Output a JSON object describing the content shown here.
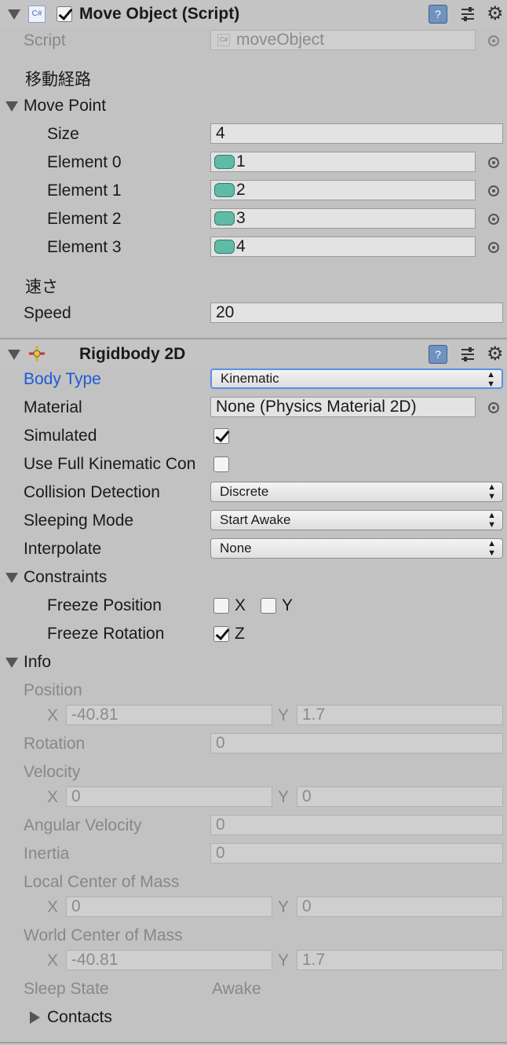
{
  "move_object": {
    "title": "Move Object (Script)",
    "script_label": "Script",
    "script_value": "moveObject",
    "header_route": "移動経路",
    "move_point_label": "Move Point",
    "size_label": "Size",
    "size_value": "4",
    "elements": [
      {
        "label": "Element 0",
        "value": "1"
      },
      {
        "label": "Element 1",
        "value": "2"
      },
      {
        "label": "Element 2",
        "value": "3"
      },
      {
        "label": "Element 3",
        "value": "4"
      }
    ],
    "header_speed": "速さ",
    "speed_label": "Speed",
    "speed_value": "20"
  },
  "rigidbody": {
    "title": "Rigidbody 2D",
    "body_type_label": "Body Type",
    "body_type_value": "Kinematic",
    "material_label": "Material",
    "material_value": "None (Physics Material 2D)",
    "simulated_label": "Simulated",
    "simulated_checked": true,
    "full_kinematic_label": "Use Full Kinematic Con",
    "full_kinematic_checked": false,
    "collision_label": "Collision Detection",
    "collision_value": "Discrete",
    "sleeping_label": "Sleeping Mode",
    "sleeping_value": "Start Awake",
    "interpolate_label": "Interpolate",
    "interpolate_value": "None",
    "constraints_label": "Constraints",
    "freeze_position_label": "Freeze Position",
    "freeze_x": "X",
    "freeze_y": "Y",
    "freeze_rotation_label": "Freeze Rotation",
    "freeze_z": "Z"
  },
  "info": {
    "label": "Info",
    "position_label": "Position",
    "position_x": "-40.81",
    "position_y": "1.7",
    "rotation_label": "Rotation",
    "rotation_value": "0",
    "velocity_label": "Velocity",
    "velocity_x": "0",
    "velocity_y": "0",
    "angular_velocity_label": "Angular Velocity",
    "angular_velocity_value": "0",
    "inertia_label": "Inertia",
    "inertia_value": "0",
    "local_com_label": "Local Center of Mass",
    "local_com_x": "0",
    "local_com_y": "0",
    "world_com_label": "World Center of Mass",
    "world_com_x": "-40.81",
    "world_com_y": "1.7",
    "sleep_state_label": "Sleep State",
    "sleep_state_value": "Awake",
    "contacts_label": "Contacts",
    "axis_x": "X",
    "axis_y": "Y"
  },
  "icons": {
    "script_file": "cs-script-icon",
    "component_rigidbody": "rigidbody-icon",
    "help": "help-book-icon",
    "presets": "presets-icon",
    "settings": "gear-icon",
    "object_picker": "object-picker-icon"
  },
  "colors": {
    "panel_bg": "#c2c2c2",
    "field_bg": "#e3e3e3",
    "gameobject_teal": "#5fbba6",
    "label_highlight": "#1f5ad8"
  }
}
